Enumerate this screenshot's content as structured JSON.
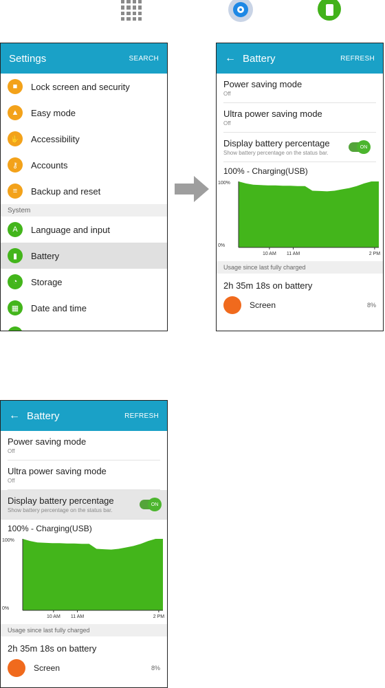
{
  "settings": {
    "header": {
      "title": "Settings",
      "action": "SEARCH"
    },
    "items_top": [
      {
        "label": "Lock screen and security",
        "icon": "lock-icon"
      },
      {
        "label": "Easy mode",
        "icon": "home-icon"
      },
      {
        "label": "Accessibility",
        "icon": "hand-icon"
      },
      {
        "label": "Accounts",
        "icon": "key-icon"
      },
      {
        "label": "Backup and reset",
        "icon": "backup-icon"
      }
    ],
    "section_label": "System",
    "items_bottom": [
      {
        "label": "Language and input",
        "icon": "language-icon"
      },
      {
        "label": "Battery",
        "icon": "battery-icon"
      },
      {
        "label": "Storage",
        "icon": "storage-icon"
      },
      {
        "label": "Date and time",
        "icon": "calendar-icon"
      }
    ]
  },
  "battery": {
    "header": {
      "title": "Battery",
      "action": "REFRESH",
      "back": "←"
    },
    "power_saving": {
      "title": "Power saving mode",
      "sub": "Off"
    },
    "ultra_power_saving": {
      "title": "Ultra power saving mode",
      "sub": "Off"
    },
    "display_percentage": {
      "title": "Display battery percentage",
      "sub": "Show battery percentage on the status bar.",
      "toggle": "ON"
    },
    "status": "100% - Charging(USB)",
    "usage_header": "Usage since last fully charged",
    "usage_total": "2h 35m 18s on battery",
    "usage_item": {
      "name": "Screen",
      "pct": "8%"
    }
  },
  "colors": {
    "header": "#1aa1c7",
    "accent_green": "#43b51b",
    "orange": "#f3a21a"
  },
  "chart_data": {
    "type": "area",
    "ylim": [
      0,
      100
    ],
    "y_ticks": [
      "100%",
      "0%"
    ],
    "x_ticks": [
      "10 AM",
      "11 AM",
      "2 PM"
    ],
    "x_tick_positions": [
      0.22,
      0.39,
      0.97
    ],
    "values": [
      100,
      97,
      95,
      94.5,
      94,
      94,
      93.5,
      93.5,
      93,
      93,
      86,
      85.5,
      85,
      86,
      88,
      90,
      93,
      97,
      100,
      100
    ]
  }
}
